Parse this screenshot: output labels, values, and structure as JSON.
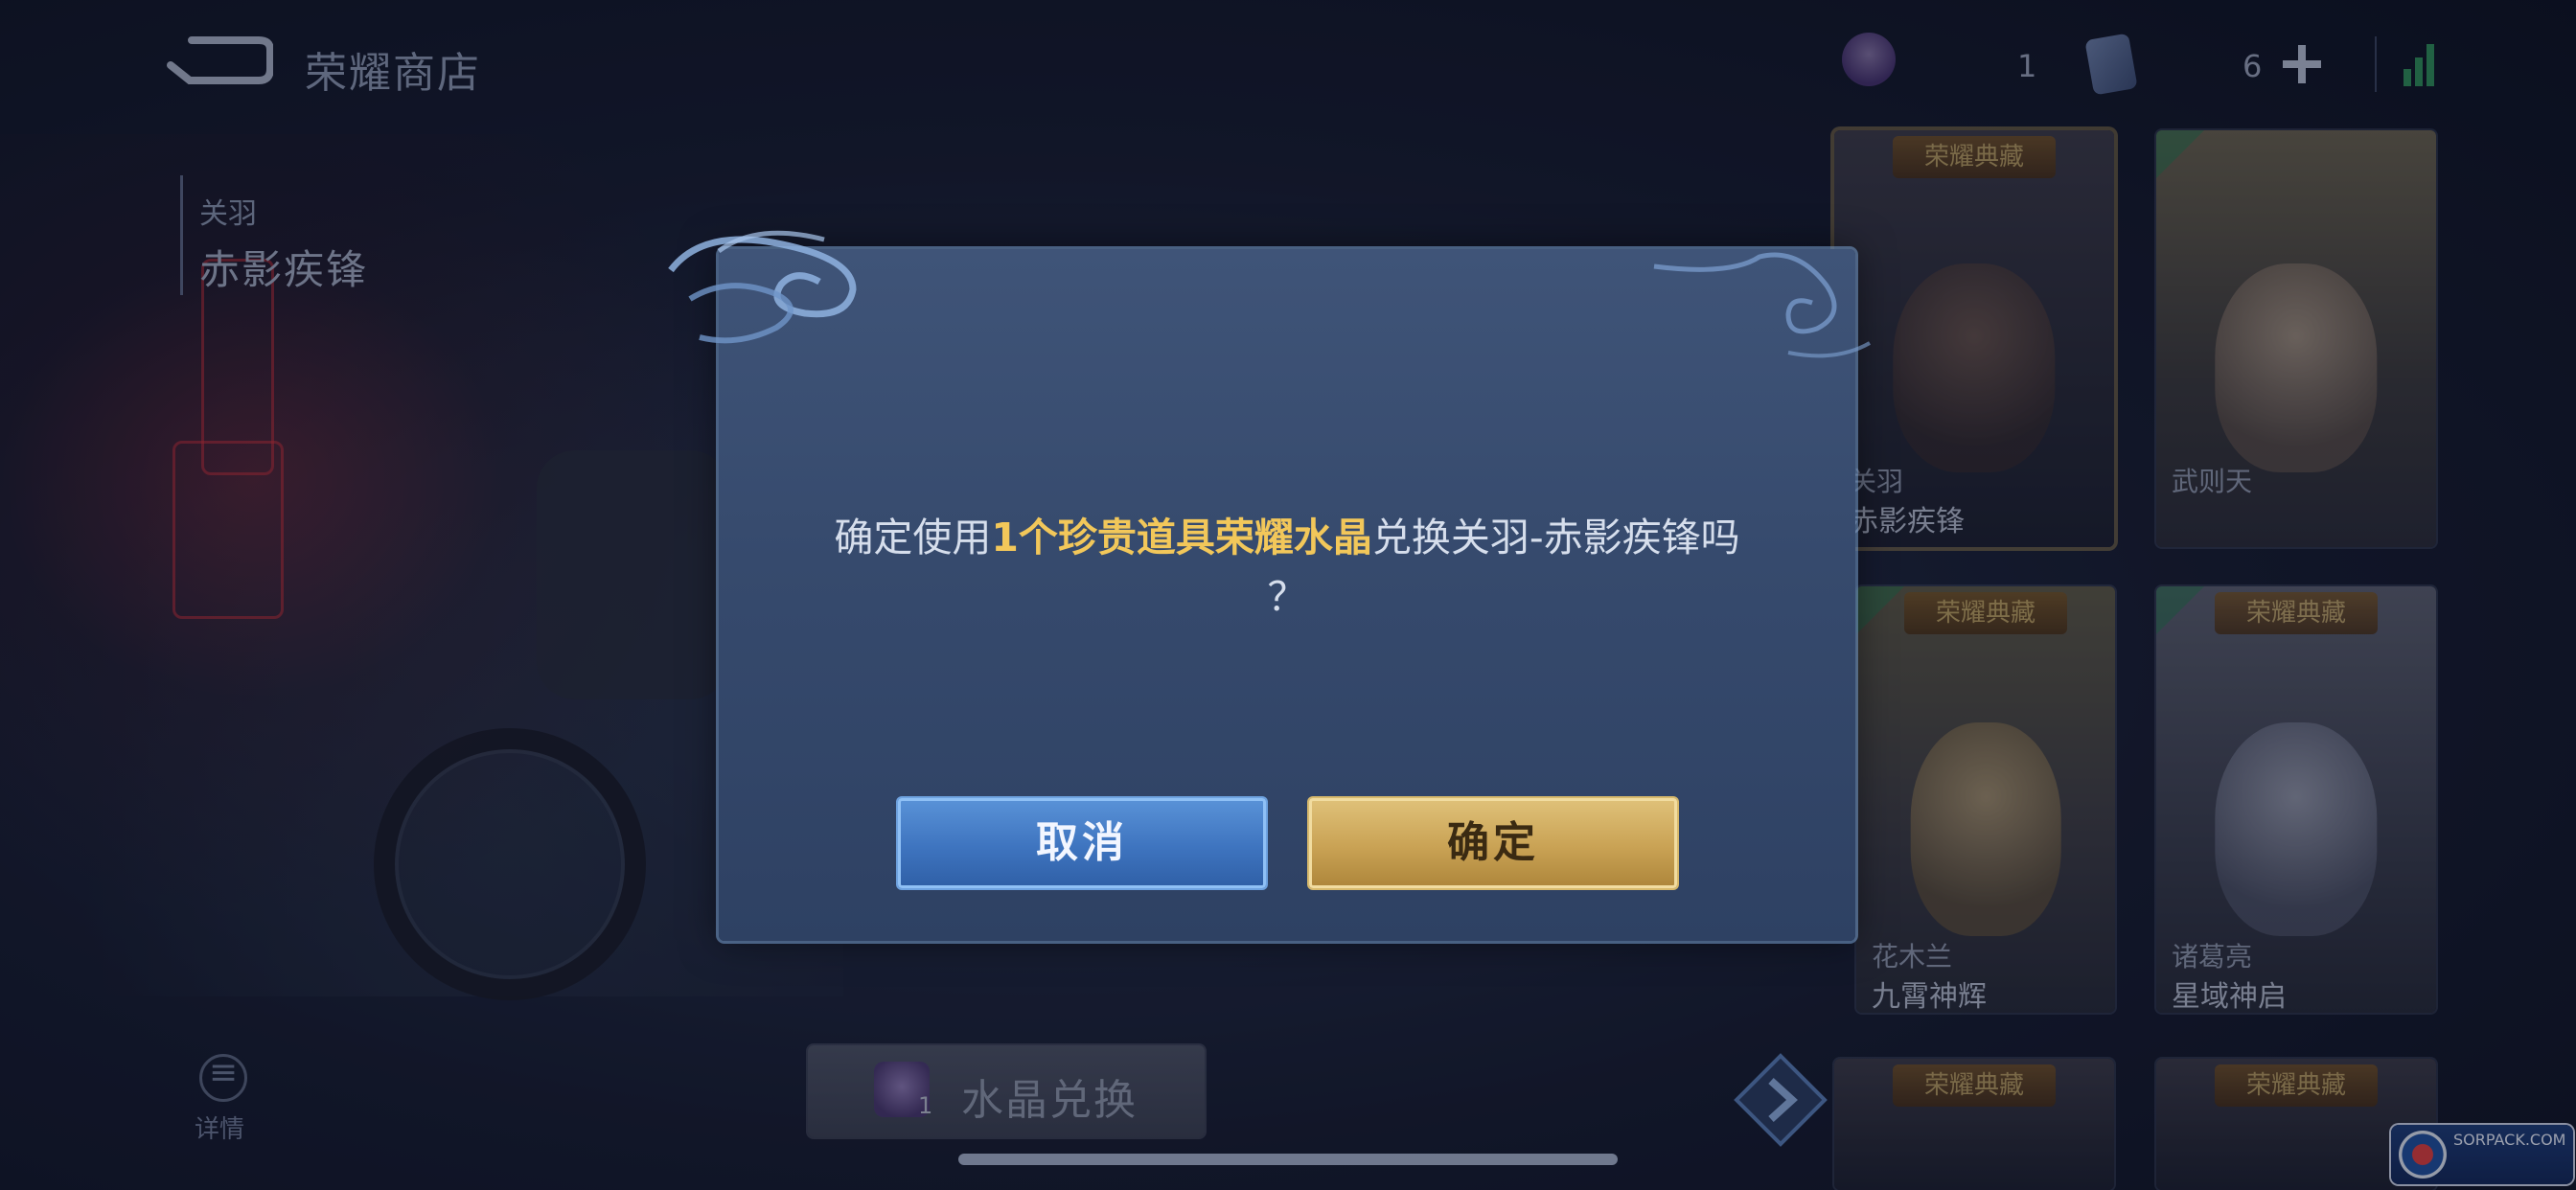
{
  "header": {
    "title": "荣耀商店",
    "crystal_count": "1",
    "coupon_count": "6"
  },
  "hero_preview": {
    "hero_name": "关羽",
    "skin_name": "赤影疾锋"
  },
  "skin_grid": [
    {
      "tag": "荣耀典藏",
      "hero": "关羽",
      "skin": "赤影疾锋",
      "selected": true
    },
    {
      "tag": "",
      "hero": "武则天",
      "skin": "",
      "selected": false
    },
    {
      "tag": "荣耀典藏",
      "hero": "花木兰",
      "skin": "九霄神辉",
      "selected": false
    },
    {
      "tag": "荣耀典藏",
      "hero": "诸葛亮",
      "skin": "星域神启",
      "selected": false
    },
    {
      "tag": "荣耀典藏",
      "hero": "",
      "skin": "",
      "selected": false
    },
    {
      "tag": "荣耀典藏",
      "hero": "",
      "skin": "",
      "selected": false
    }
  ],
  "bottom_bar": {
    "details_label": "详情",
    "exchange_label": "水晶兑换",
    "exchange_qty": "1"
  },
  "dialog": {
    "message_prefix": "确定使用",
    "message_highlight": "1个珍贵道具荣耀水晶",
    "message_suffix": "兑换关羽-赤影疾锋吗",
    "message_end": "？",
    "cancel_label": "取消",
    "confirm_label": "确定"
  },
  "watermark": {
    "text": "SORPACK.COM"
  },
  "colors": {
    "highlight": "#f2c75a",
    "cancel_blue": "#3e74bf",
    "confirm_gold": "#c9a254",
    "dialog_bg": "#364a6d"
  },
  "icons": [
    "back-arrow-icon",
    "crystal-icon",
    "card-icon",
    "plus-icon",
    "signal-icon",
    "details-icon",
    "crystal-exchange-icon",
    "arrow-right-icon"
  ]
}
